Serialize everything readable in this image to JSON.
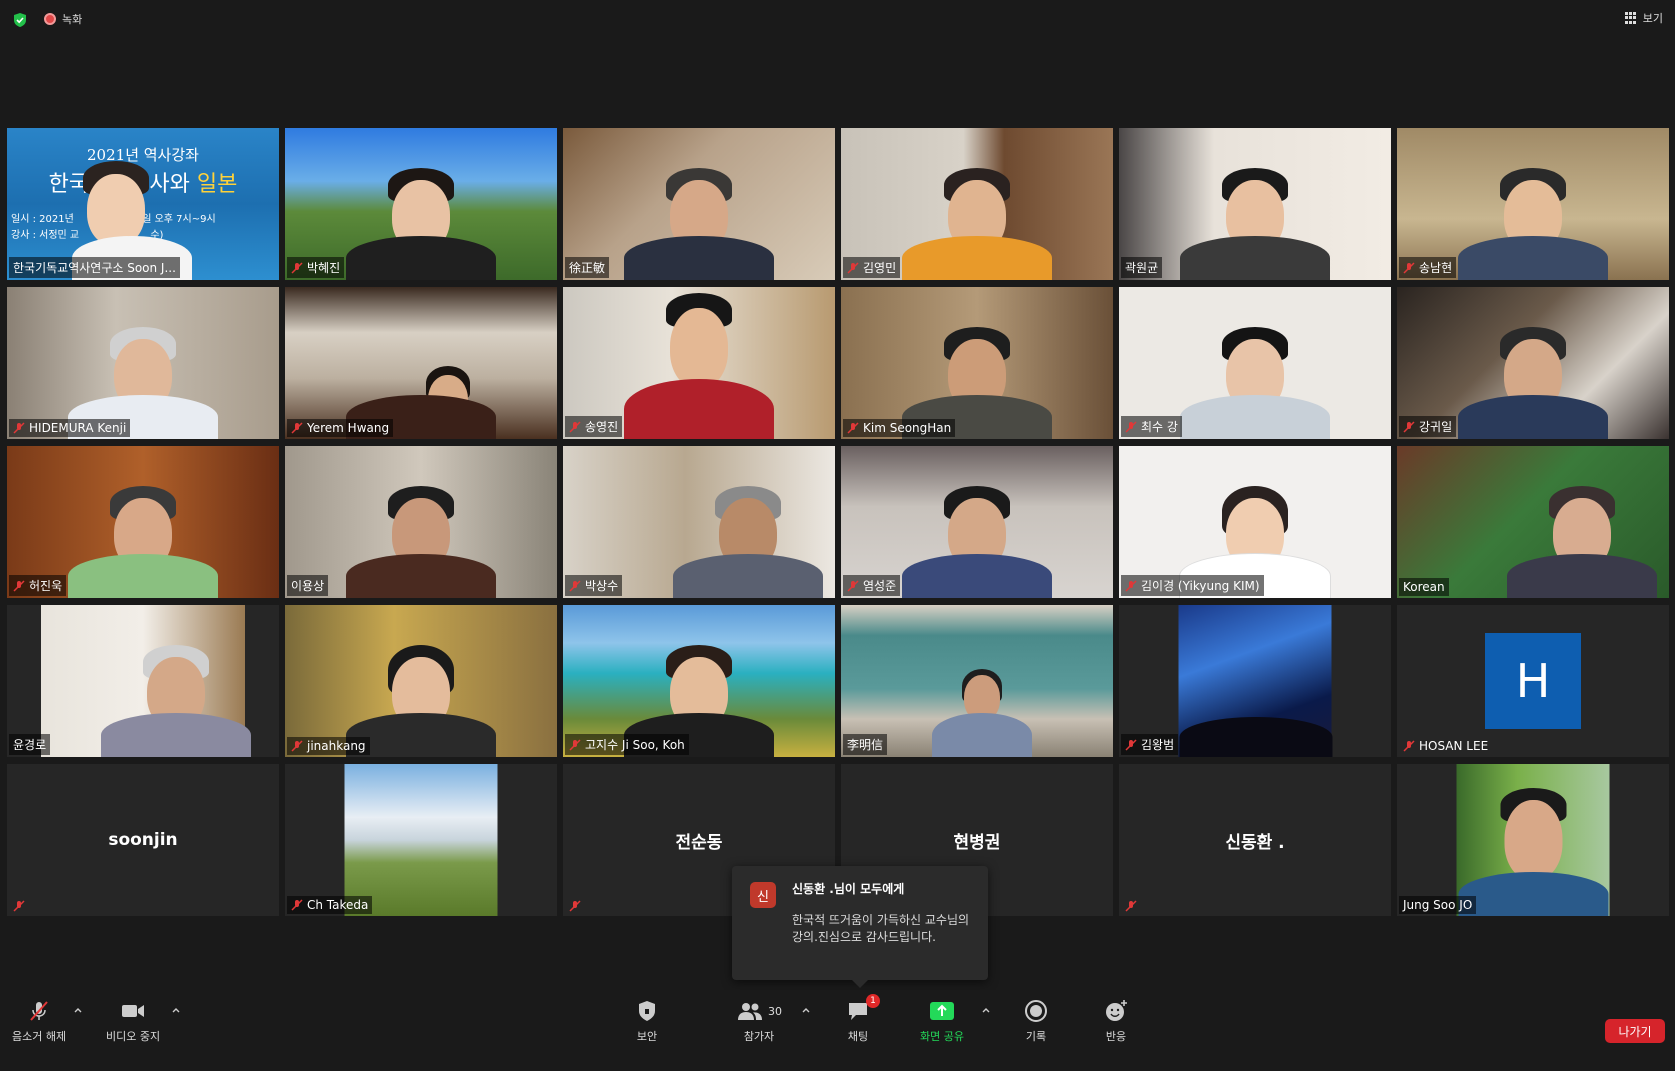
{
  "topbar": {
    "recording_label": "녹화",
    "view_label": "보기"
  },
  "slide": {
    "line1": "2021년 역사강좌",
    "line2_prefix": "한국",
    "line2_mid": "교사와 ",
    "line2_highlight": "일본",
    "line3": "일시 : 2021년",
    "line3b": "매주",
    "line3c": "일 오후 7시~9시",
    "line4": "강사 : 서정민 교",
    "line4b": "가",
    "line4c": "수)"
  },
  "tiles": [
    {
      "name": "한국기독교역사연구소 Soon J...",
      "muted": false,
      "active": true
    },
    {
      "name": "박혜진",
      "muted": true
    },
    {
      "name": "徐正敏",
      "muted": false
    },
    {
      "name": "김영민",
      "muted": true
    },
    {
      "name": "곽원균",
      "muted": false
    },
    {
      "name": "송남현",
      "muted": true
    },
    {
      "name": "HIDEMURA Kenji",
      "muted": true
    },
    {
      "name": "Yerem Hwang",
      "muted": true
    },
    {
      "name": "송영진",
      "muted": true
    },
    {
      "name": "Kim SeongHan",
      "muted": true
    },
    {
      "name": "최수 강",
      "muted": true
    },
    {
      "name": "강귀일",
      "muted": true
    },
    {
      "name": "허진욱",
      "muted": true
    },
    {
      "name": "이용상",
      "muted": false
    },
    {
      "name": "박상수",
      "muted": true
    },
    {
      "name": "염성준",
      "muted": true
    },
    {
      "name": "김이경 (Yikyung KIM)",
      "muted": true
    },
    {
      "name": "Korean",
      "muted": false
    },
    {
      "name": "윤경로",
      "muted": false
    },
    {
      "name": "jinahkang",
      "muted": true
    },
    {
      "name": "고지수 Ji Soo, Koh",
      "muted": true
    },
    {
      "name": "李明信",
      "muted": false
    },
    {
      "name": "김왕범",
      "muted": true
    },
    {
      "name": "HOSAN LEE",
      "muted": true,
      "avatar_letter": "H"
    },
    {
      "name": "soonjin",
      "muted": true,
      "video_off": true
    },
    {
      "name": "Ch Takeda",
      "muted": true
    },
    {
      "name": "전순동",
      "muted": true,
      "video_off": true
    },
    {
      "name": "현병권",
      "muted": false,
      "video_off": true
    },
    {
      "name": "신동환 .",
      "muted": true,
      "video_off": true
    },
    {
      "name": "Jung Soo JO",
      "muted": false
    }
  ],
  "chat_popup": {
    "avatar_char": "신",
    "title": "신동환 .님이 모두에게",
    "message": "한국적 뜨거움이 가득하신 교수님의 강의.진심으로 감사드립니다."
  },
  "toolbar": {
    "unmute_label": "음소거 해제",
    "video_label": "비디오 중지",
    "security_label": "보안",
    "participants_label": "참가자",
    "participants_count": "30",
    "chat_label": "채팅",
    "chat_badge": "1",
    "share_label": "화면 공유",
    "record_label": "기록",
    "reactions_label": "반응",
    "leave_label": "나가기"
  },
  "colors": {
    "accent_green": "#23d959",
    "leave_red": "#d6242b",
    "active_speaker": "#d7e64a"
  }
}
